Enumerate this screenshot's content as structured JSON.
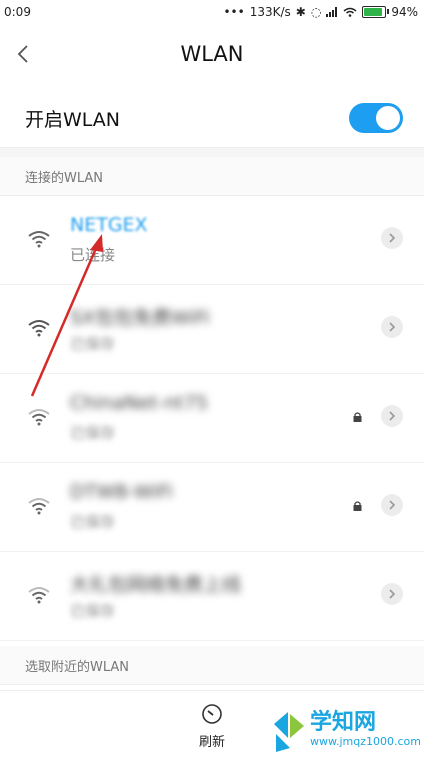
{
  "statusbar": {
    "time": "0:09",
    "dots": "•••",
    "speed": "133K/s",
    "battery": "94%"
  },
  "header": {
    "title": "WLAN"
  },
  "wlan_toggle": {
    "label": "开启WLAN",
    "enabled": true,
    "accent": "#1e9ef0"
  },
  "sections": {
    "connected": "连接的WLAN",
    "nearby": "选取附近的WLAN"
  },
  "networks": [
    {
      "ssid": "NETGEX",
      "status": "已连接",
      "locked": false,
      "connected": true
    },
    {
      "ssid": "SX包包免费WiFi",
      "status": "已保存",
      "locked": false,
      "connected": false
    },
    {
      "ssid": "ChinaNet-nt75",
      "status": "已保存",
      "locked": true,
      "connected": false
    },
    {
      "ssid": "DTWB-WiFi",
      "status": "已保存",
      "locked": true,
      "connected": false
    },
    {
      "ssid": "大礼包网络免费上线",
      "status": "已保存",
      "locked": false,
      "connected": false
    }
  ],
  "bottom": {
    "refresh_label": "刷新"
  },
  "watermark": {
    "name": "学知网",
    "url": "www.jmqz1000.com"
  }
}
